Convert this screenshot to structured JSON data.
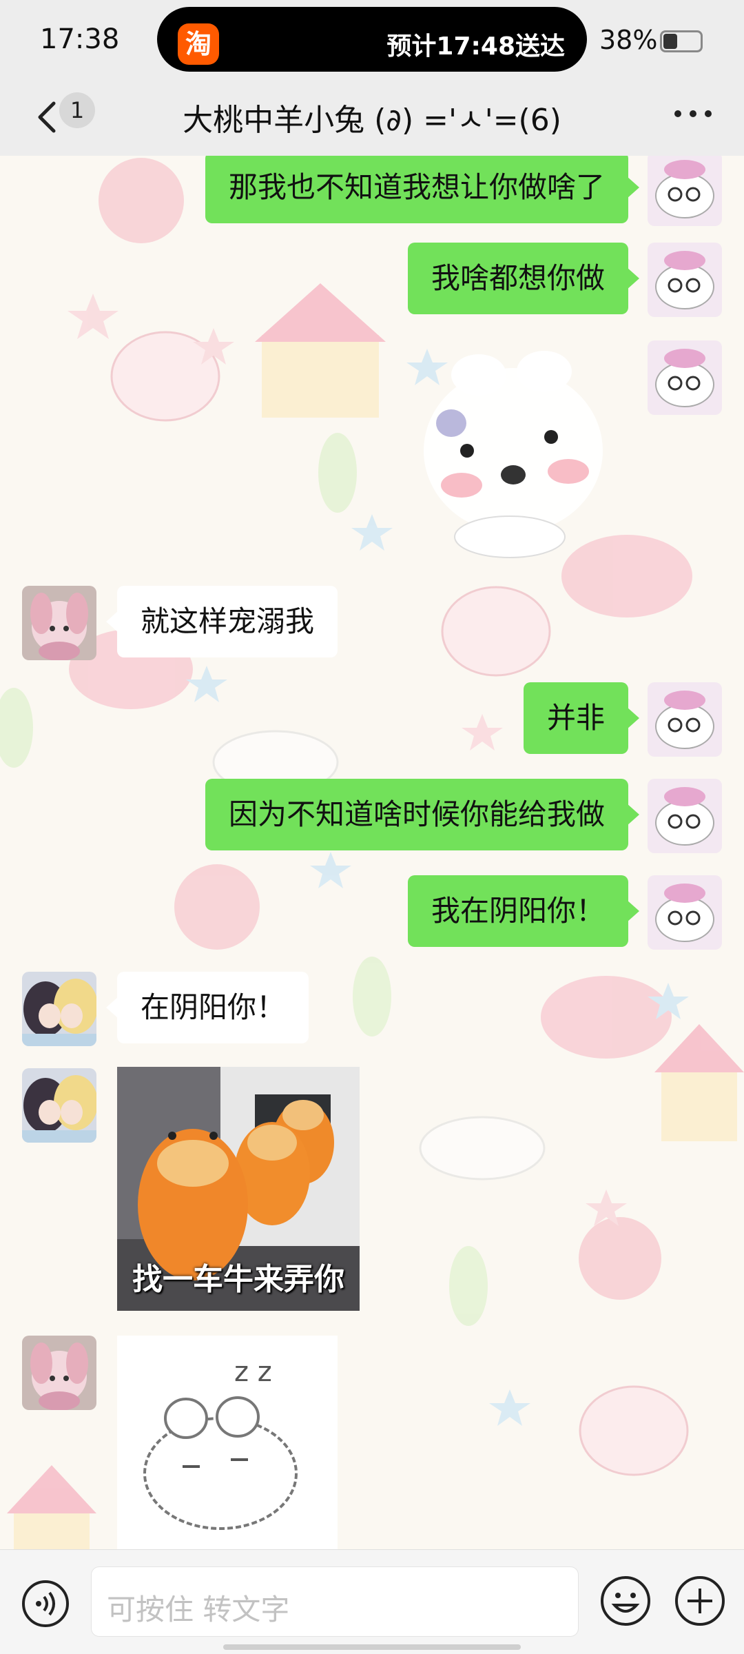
{
  "status_bar": {
    "time": "17:38",
    "island_app_icon": "淘",
    "island_text": "预计17:48送达",
    "battery_percent": "38%",
    "battery_level": 0.38
  },
  "header": {
    "back_icon": "chevron-left-icon",
    "unread_count": "1",
    "title": "大桃中羊小兔 (∂) ='ㅅ'=(6)",
    "more_icon": "more-dots-icon"
  },
  "messages": [
    {
      "side": "me",
      "text": "那我也不知道我想让你做啥了"
    },
    {
      "side": "me",
      "text": "我啥都想你做"
    },
    {
      "side": "me",
      "type": "sticker",
      "sticker": "white-bunny-sticker"
    },
    {
      "side": "other",
      "text": "就这样宠溺我"
    },
    {
      "side": "me",
      "text": "并非"
    },
    {
      "side": "me",
      "text": "因为不知道啥时候你能给我做"
    },
    {
      "side": "me",
      "text": "我在阴阳你！"
    },
    {
      "side": "other",
      "text": "在阴阳你！"
    },
    {
      "side": "other",
      "type": "image",
      "caption": "找一车牛来弄你"
    },
    {
      "side": "other",
      "type": "sticker",
      "sticker": "sleeping-bunny-sticker",
      "zzz": "z z"
    }
  ],
  "input": {
    "placeholder": "可按住 转文字",
    "voice_icon": "voice-icon",
    "emoji_icon": "emoji-icon",
    "plus_icon": "plus-icon"
  },
  "colors": {
    "my_bubble": "#72e15a",
    "other_bubble": "#ffffff",
    "header_bg": "#ededed"
  }
}
